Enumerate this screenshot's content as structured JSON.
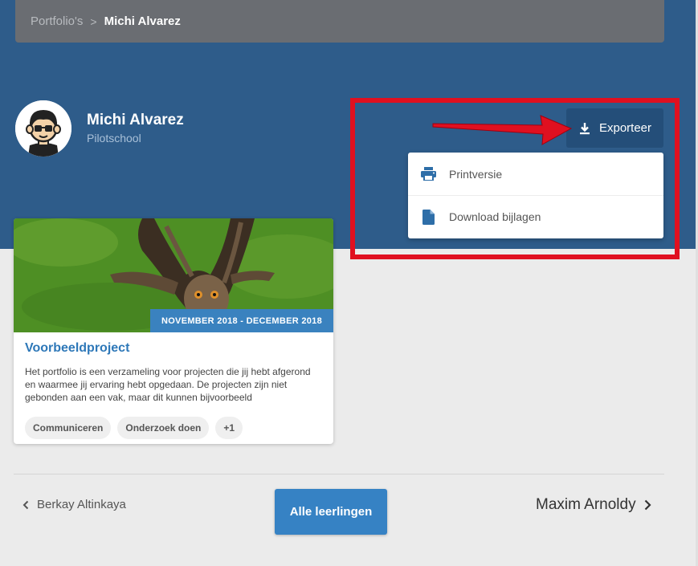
{
  "breadcrumb": {
    "parent": "Portfolio's",
    "separator": ">",
    "current": "Michi Alvarez"
  },
  "profile": {
    "name": "Michi Alvarez",
    "school": "Pilotschool",
    "avatar_icon": "student-avatar-icon"
  },
  "export": {
    "label": "Exporteer",
    "icon": "download-icon",
    "menu": [
      {
        "label": "Printversie",
        "icon": "printer-icon"
      },
      {
        "label": "Download bijlagen",
        "icon": "file-icon"
      }
    ]
  },
  "project_card": {
    "date_range": "NOVEMBER 2018 - DECEMBER 2018",
    "title": "Voorbeeldproject",
    "description": "Het portfolio is een verzameling voor projecten die jij hebt afgerond en waarmee jij ervaring hebt opgedaan. De projecten zijn niet gebonden aan een vak, maar dit kunnen bijvoorbeeld",
    "tags": [
      "Communiceren",
      "Onderzoek doen",
      "+1"
    ]
  },
  "footer_nav": {
    "prev": "Berkay Altinkaya",
    "all": "Alle leerlingen",
    "next": "Maxim Arnoldy"
  },
  "colors": {
    "hero": "#2e5c8a",
    "accent": "#3682c4",
    "highlight": "#e01020"
  }
}
